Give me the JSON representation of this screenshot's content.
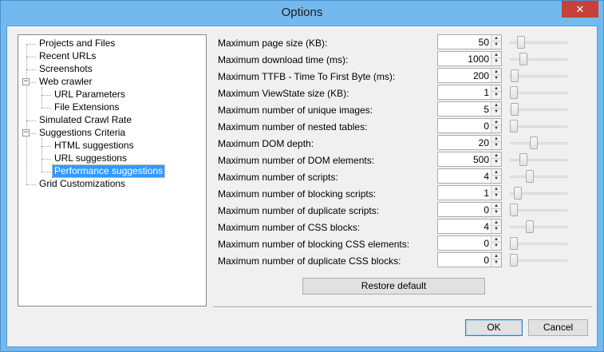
{
  "window": {
    "title": "Options",
    "close_glyph": "✕"
  },
  "tree": [
    {
      "label": "Projects and Files",
      "level": 0
    },
    {
      "label": "Recent URLs",
      "level": 0
    },
    {
      "label": "Screenshots",
      "level": 0
    },
    {
      "label": "Web crawler",
      "level": 0,
      "expander": "−"
    },
    {
      "label": "URL Parameters",
      "level": 1
    },
    {
      "label": "File Extensions",
      "level": 1
    },
    {
      "label": "Simulated Crawl Rate",
      "level": 0
    },
    {
      "label": "Suggestions Criteria",
      "level": 0,
      "expander": "−"
    },
    {
      "label": "HTML suggestions",
      "level": 1
    },
    {
      "label": "URL suggestions",
      "level": 1
    },
    {
      "label": "Performance suggestions",
      "level": 1,
      "selected": true
    },
    {
      "label": "Grid Customizations",
      "level": 0
    }
  ],
  "settings": [
    {
      "label": "Maximum page size (KB):",
      "value": "50",
      "slider": 0.15
    },
    {
      "label": "Maximum download time (ms):",
      "value": "1000",
      "slider": 0.2
    },
    {
      "label": "Maximum TTFB - Time To First Byte (ms):",
      "value": "200",
      "slider": 0.02
    },
    {
      "label": "Maximum ViewState size (KB):",
      "value": "1",
      "slider": 0.0
    },
    {
      "label": "Maximum number of unique images:",
      "value": "5",
      "slider": 0.02
    },
    {
      "label": "Maximum number of nested tables:",
      "value": "0",
      "slider": 0.0
    },
    {
      "label": "Maximum DOM depth:",
      "value": "20",
      "slider": 0.4
    },
    {
      "label": "Maximum number of DOM elements:",
      "value": "500",
      "slider": 0.2
    },
    {
      "label": "Maximum number of scripts:",
      "value": "4",
      "slider": 0.33
    },
    {
      "label": "Maximum number of blocking scripts:",
      "value": "1",
      "slider": 0.08
    },
    {
      "label": "Maximum number of duplicate scripts:",
      "value": "0",
      "slider": 0.0
    },
    {
      "label": "Maximum number of CSS blocks:",
      "value": "4",
      "slider": 0.33
    },
    {
      "label": "Maximum number of blocking CSS elements:",
      "value": "0",
      "slider": 0.0
    },
    {
      "label": "Maximum number of duplicate CSS blocks:",
      "value": "0",
      "slider": 0.0
    }
  ],
  "buttons": {
    "restore_default": "Restore default",
    "ok": "OK",
    "cancel": "Cancel"
  }
}
